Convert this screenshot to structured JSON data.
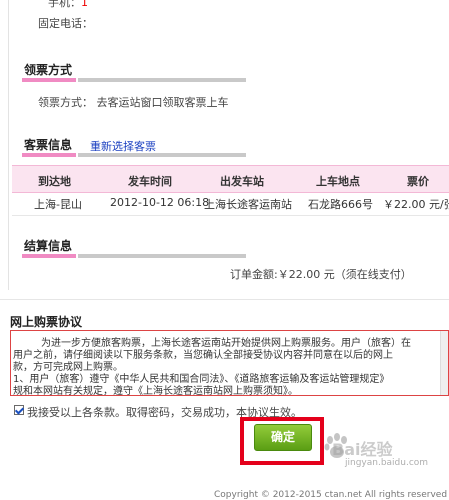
{
  "contact": {
    "mobile_label": "手机：",
    "mobile_value": "1",
    "phone_label": "固定电话："
  },
  "pickup": {
    "title": "领票方式",
    "label": "领票方式：",
    "value": "去客运站窗口领取客票上车"
  },
  "ticket_info": {
    "title": "客票信息",
    "reselect_link": "重新选择客票",
    "columns": [
      "到达地",
      "发车时间",
      "出发车站",
      "上车地点",
      "票价"
    ],
    "row": [
      "上海-昆山",
      "2012-10-12 06:18",
      "上海长途客运南站",
      "石龙路666号",
      "￥22.00 元/张"
    ]
  },
  "settlement": {
    "title": "结算信息",
    "amount_text": "订单金额:￥22.00 元（须在线支付）"
  },
  "protocol": {
    "title": "网上购票协议",
    "lines": [
      "为进一步方便旅客购票，上海长途客运南站开始提供网上购票服务。用户（旅客）在",
      "用户之前，请仔细阅读以下服务条款，当您确认全部接受协议内容并同意在以后的网上",
      "款，方可完成网上购票。",
      "1、用户（旅客）遵守《中华人民共和国合同法》、《道路旅客运输及客运站管理规定》",
      "规和本网站有关规定，遵守《上海长途客运南站网上购票须知》。"
    ],
    "agree_text": "我接受以上各条款。取得密码，交易成功，本协议生效。"
  },
  "actions": {
    "confirm_label": "确定"
  },
  "watermark": {
    "text": "Bai",
    "text2": "经验",
    "domain": "jingyan.baidu.com"
  },
  "footer": {
    "copyright": "Copyright © 2012-2015 ctan.net All rights reserved"
  },
  "colors": {
    "accent_pink": "#f08bc3",
    "highlight_red": "#e4001b",
    "button_green": "#6aaa1c",
    "link_blue": "#1a3fc0"
  }
}
